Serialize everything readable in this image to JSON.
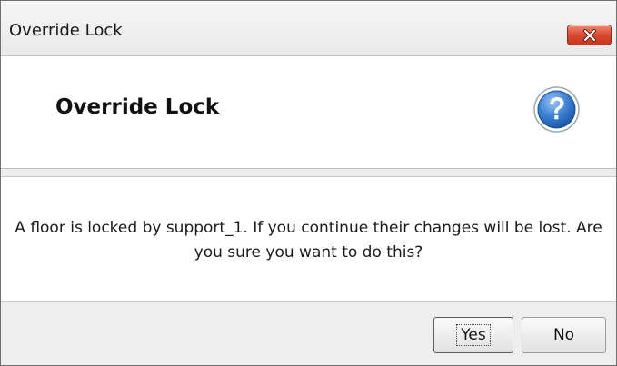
{
  "window": {
    "title": "Override Lock",
    "close_icon": "close-icon"
  },
  "header": {
    "title": "Override Lock",
    "icon": "help-icon"
  },
  "message": {
    "text": "A floor is locked by support_1. If you continue their changes will be lost. Are you sure you want to do this?"
  },
  "buttons": {
    "yes_label": "Yes",
    "no_label": "No"
  },
  "colors": {
    "close_button": "#d9492f",
    "help_icon": "#2f6fbf"
  }
}
